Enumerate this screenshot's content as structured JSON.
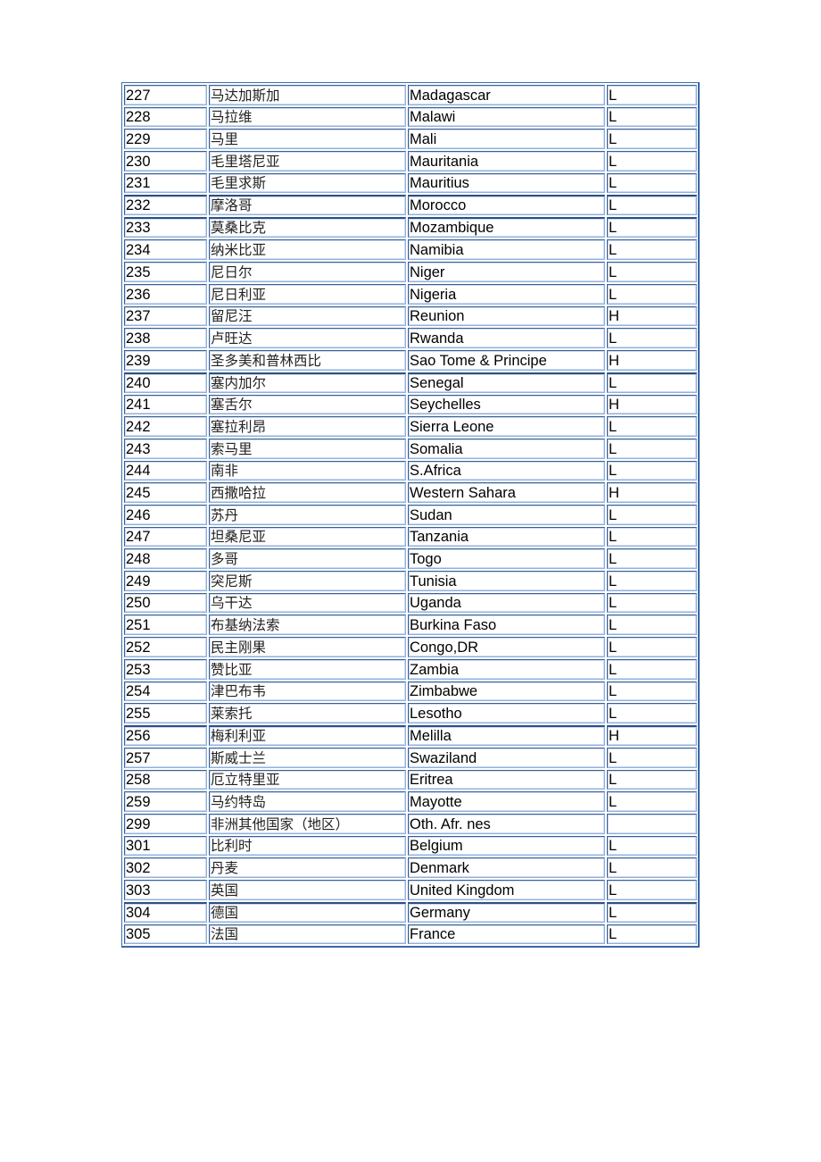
{
  "document": {
    "table": {
      "columns": [
        "code",
        "name_zh",
        "name_en",
        "category"
      ],
      "rows": [
        {
          "code": "227",
          "name_zh": "马达加斯加",
          "name_en": "Madagascar",
          "category": "L"
        },
        {
          "code": "228",
          "name_zh": "马拉维",
          "name_en": "Malawi",
          "category": "L"
        },
        {
          "code": "229",
          "name_zh": "马里",
          "name_en": "Mali",
          "category": "L"
        },
        {
          "code": "230",
          "name_zh": "毛里塔尼亚",
          "name_en": "Mauritania",
          "category": "L"
        },
        {
          "code": "231",
          "name_zh": "毛里求斯",
          "name_en": "Mauritius",
          "category": "L"
        },
        {
          "code": "232",
          "name_zh": "摩洛哥",
          "name_en": "Morocco",
          "category": "L"
        },
        {
          "code": "233",
          "name_zh": "莫桑比克",
          "name_en": "Mozambique",
          "category": "L"
        },
        {
          "code": "234",
          "name_zh": "纳米比亚",
          "name_en": "Namibia",
          "category": "L"
        },
        {
          "code": "235",
          "name_zh": "尼日尔",
          "name_en": "Niger",
          "category": "L"
        },
        {
          "code": "236",
          "name_zh": "尼日利亚",
          "name_en": "Nigeria",
          "category": "L"
        },
        {
          "code": "237",
          "name_zh": "留尼汪",
          "name_en": "Reunion",
          "category": "H"
        },
        {
          "code": "238",
          "name_zh": "卢旺达",
          "name_en": "Rwanda",
          "category": "L"
        },
        {
          "code": "239",
          "name_zh": "圣多美和普林西比",
          "name_en": "Sao Tome & Principe",
          "category": "H"
        },
        {
          "code": "240",
          "name_zh": "塞内加尔",
          "name_en": "Senegal",
          "category": "L"
        },
        {
          "code": "241",
          "name_zh": "塞舌尔",
          "name_en": "Seychelles",
          "category": "H"
        },
        {
          "code": "242",
          "name_zh": "塞拉利昂",
          "name_en": "Sierra Leone",
          "category": "L"
        },
        {
          "code": "243",
          "name_zh": "索马里",
          "name_en": "Somalia",
          "category": "L"
        },
        {
          "code": "244",
          "name_zh": "南非",
          "name_en": "S.Africa",
          "category": "L"
        },
        {
          "code": "245",
          "name_zh": "西撒哈拉",
          "name_en": "Western Sahara",
          "category": "H"
        },
        {
          "code": "246",
          "name_zh": "苏丹",
          "name_en": "Sudan",
          "category": "L"
        },
        {
          "code": "247",
          "name_zh": "坦桑尼亚",
          "name_en": "Tanzania",
          "category": "L"
        },
        {
          "code": "248",
          "name_zh": "多哥",
          "name_en": "Togo",
          "category": "L"
        },
        {
          "code": "249",
          "name_zh": "突尼斯",
          "name_en": "Tunisia",
          "category": "L"
        },
        {
          "code": "250",
          "name_zh": "乌干达",
          "name_en": "Uganda",
          "category": "L"
        },
        {
          "code": "251",
          "name_zh": "布基纳法索",
          "name_en": "Burkina Faso",
          "category": "L"
        },
        {
          "code": "252",
          "name_zh": "民主刚果",
          "name_en": "Congo,DR",
          "category": "L"
        },
        {
          "code": "253",
          "name_zh": "赞比亚",
          "name_en": "Zambia",
          "category": "L"
        },
        {
          "code": "254",
          "name_zh": "津巴布韦",
          "name_en": "Zimbabwe",
          "category": "L"
        },
        {
          "code": "255",
          "name_zh": "莱索托",
          "name_en": "Lesotho",
          "category": "L"
        },
        {
          "code": "256",
          "name_zh": "梅利利亚",
          "name_en": "Melilla",
          "category": "H"
        },
        {
          "code": "257",
          "name_zh": "斯威士兰",
          "name_en": "Swaziland",
          "category": "L"
        },
        {
          "code": "258",
          "name_zh": "厄立特里亚",
          "name_en": "Eritrea",
          "category": "L"
        },
        {
          "code": "259",
          "name_zh": "马约特岛",
          "name_en": "Mayotte",
          "category": "L"
        },
        {
          "code": "299",
          "name_zh": "非洲其他国家（地区）",
          "name_en": "Oth. Afr. nes",
          "category": ""
        },
        {
          "code": "301",
          "name_zh": "比利时",
          "name_en": "Belgium",
          "category": "L"
        },
        {
          "code": "302",
          "name_zh": "丹麦",
          "name_en": "Denmark",
          "category": "L"
        },
        {
          "code": "303",
          "name_zh": "英国",
          "name_en": "United Kingdom",
          "category": "L"
        },
        {
          "code": "304",
          "name_zh": "德国",
          "name_en": "Germany",
          "category": "L"
        },
        {
          "code": "305",
          "name_zh": "法国",
          "name_en": "France",
          "category": "L"
        }
      ]
    }
  }
}
